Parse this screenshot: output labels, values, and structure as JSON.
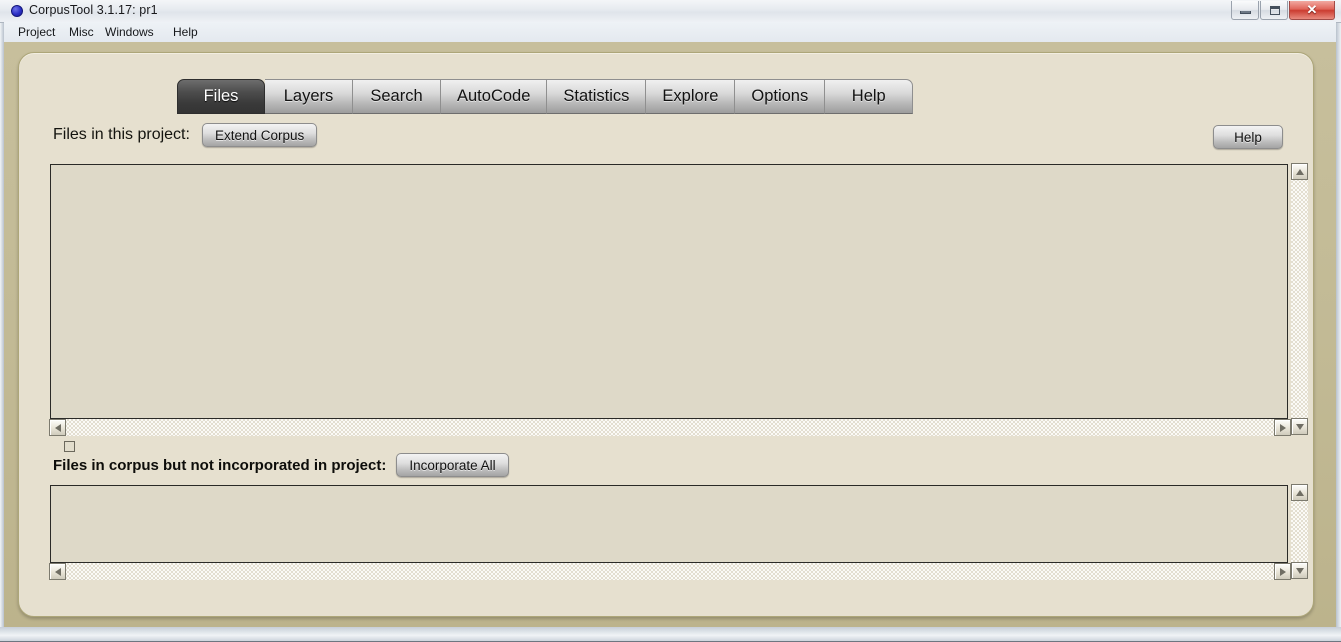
{
  "window": {
    "title": "CorpusTool 3.1.17: pr1",
    "icon": "blue-circle-icon",
    "buttons": {
      "minimize": "minimize",
      "maximize": "maximize",
      "close": "✕"
    }
  },
  "menubar": {
    "items": [
      {
        "label": "Project"
      },
      {
        "label": "Misc"
      },
      {
        "label": "Windows"
      },
      {
        "label": "Help"
      }
    ]
  },
  "tabs": [
    {
      "label": "Files",
      "active": true
    },
    {
      "label": "Layers",
      "active": false
    },
    {
      "label": "Search",
      "active": false
    },
    {
      "label": "AutoCode",
      "active": false
    },
    {
      "label": "Statistics",
      "active": false
    },
    {
      "label": "Explore",
      "active": false
    },
    {
      "label": "Options",
      "active": false
    },
    {
      "label": "Help",
      "active": false
    }
  ],
  "main": {
    "help_button": "Help",
    "project_files": {
      "label": "Files in this project:",
      "extend_button": "Extend Corpus",
      "items": []
    },
    "corpus_files": {
      "label": "Files in corpus but not incorporated in project:",
      "incorporate_button": "Incorporate All",
      "items": []
    }
  },
  "colors": {
    "panel_bg": "#e6e0cf",
    "app_backdrop": "#c2ba95",
    "active_tab": "#3a3a3a",
    "close_button": "#cb3c30"
  }
}
